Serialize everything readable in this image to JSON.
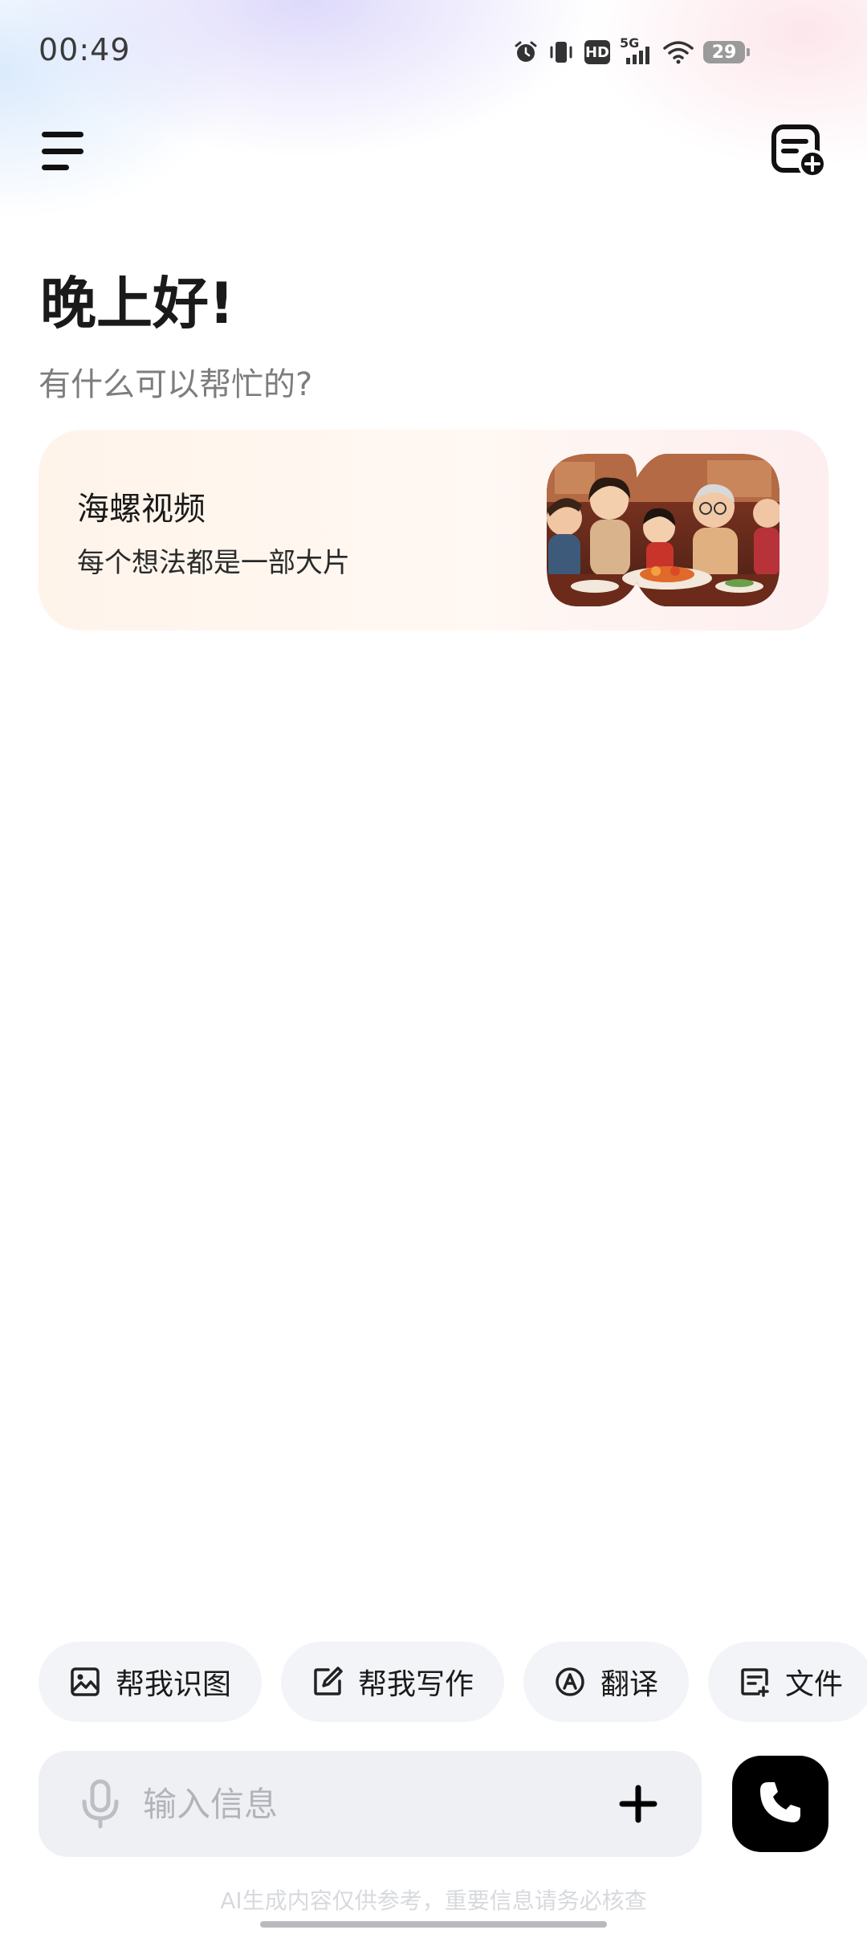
{
  "status_bar": {
    "time": "00:49",
    "icons": [
      "alarm-icon",
      "vibrate-icon",
      "hd-icon",
      "signal-5g-icon",
      "wifi-icon",
      "battery-icon"
    ],
    "network": "5G",
    "hd_label": "HD",
    "battery": "29"
  },
  "header": {
    "menu_icon": "hamburger-menu-icon",
    "new_chat_icon": "new-chat-icon"
  },
  "greeting": {
    "title": "晚上好!",
    "subtitle": "有什么可以帮忙的?"
  },
  "promo": {
    "title": "海螺视频",
    "subtitle": "每个想法都是一部大片"
  },
  "chips": [
    {
      "label": "帮我识图",
      "icon": "image-icon"
    },
    {
      "label": "帮我写作",
      "icon": "edit-icon"
    },
    {
      "label": "翻译",
      "icon": "translate-icon"
    },
    {
      "label": "文件",
      "icon": "document-icon"
    }
  ],
  "input": {
    "placeholder": "输入信息",
    "mic_icon": "microphone-icon",
    "plus_icon": "plus-icon"
  },
  "call_button": {
    "icon": "phone-icon"
  },
  "disclaimer": "AI生成内容仅供参考，重要信息请务必核查",
  "colors": {
    "accent": "#000000",
    "chip_bg": "#f3f4f7",
    "input_bg": "#eff0f4",
    "promo_bg_start": "#fff4ea",
    "promo_bg_end": "#fdeeef"
  }
}
